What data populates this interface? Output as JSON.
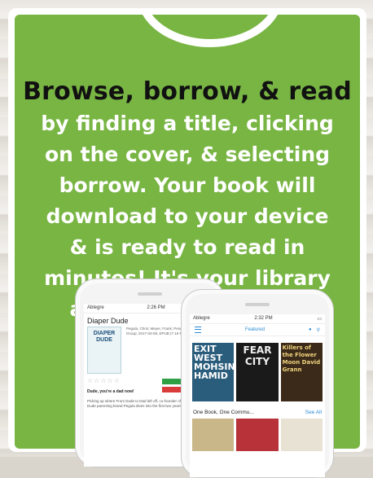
{
  "headline": "Browse, borrow, & read",
  "body": "by finding a title, clicking on the cover, & selecting borrow. Your book will download to your device & is ready to read in minutes!   It's your library any time, anywhere.",
  "colors": {
    "green": "#78b543",
    "white": "#ffffff",
    "headline": "#111111"
  },
  "phone_back": {
    "status_left": "Ablegre",
    "status_time": "2:26 PM",
    "book_title": "Diaper Dude",
    "cover_title": "DIAPER DUDE",
    "meta": "Pegula, Chris; Meyer, Frank; Penguin Publishing Group; 2017-03-06; EPUB (7.16 MB); 304 pages",
    "read_label": "READ",
    "return_label": "RETURN",
    "stars": "☆☆☆☆☆",
    "tagline": "Dude, you're a dad now!",
    "description": "Picking up where From Dude to Dad left off, co-founder of the popular Diaper Dude parenting brand Pegula dives into the first two years of parenting"
  },
  "phone_front": {
    "status_left": "Ablegre",
    "status_time": "2:32 PM",
    "nav_title": "Featured",
    "covers": [
      "EXIT WEST MOHSIN HAMID",
      "FEAR CITY",
      "Killers of the Flower Moon David Grann"
    ],
    "section_title": "One Book, One Commu...",
    "see_all": "See All",
    "icons": [
      "menu-icon",
      "user-icon",
      "search-icon"
    ]
  }
}
